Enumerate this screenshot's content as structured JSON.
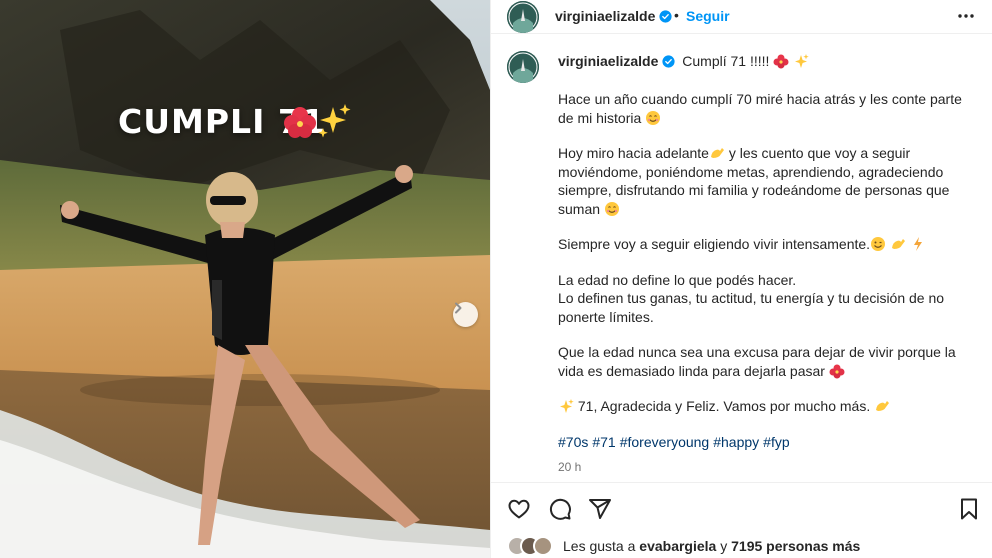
{
  "post": {
    "username": "virginiaelizalde",
    "follow_label": "Seguir",
    "separator": "•"
  },
  "media": {
    "overlay_text": "CUMPLI 71",
    "overlay_emoji": [
      "hibiscus-emoji",
      "sparkles-emoji"
    ],
    "next_icon": "chevron-right-icon"
  },
  "caption": {
    "headline": "Cumplí 71 !!!!!",
    "paragraphs": [
      [
        "Hace un año cuando cumplí 70 miré hacia atrás y les conte parte",
        "de mi historia"
      ],
      [
        "Hoy miro hacia adelante",
        "y les cuento que voy a seguir",
        "moviéndome, poniéndome metas, aprendiendo, agradeciendo",
        "siempre, disfrutando mi familia y rodeándome de personas que",
        "suman"
      ],
      [
        "Siempre voy a seguir eligiendo vivir intensamente."
      ],
      [
        "La edad no define lo que podés hacer.",
        "Lo definen tus ganas, tu actitud, tu energía y tu decisión de no",
        "ponerte límites."
      ],
      [
        "Que la edad nunca sea una excusa para dejar de vivir porque la",
        "vida es demasiado linda para dejarla pasar"
      ],
      [
        "71, Agradecida y Feliz. Vamos por mucho más."
      ]
    ],
    "hashtags": [
      "#70s",
      "#71",
      "#foreveryoung",
      "#happy",
      "#fyp"
    ],
    "time": "20 h"
  },
  "likes": {
    "prefix": "Les gusta a",
    "user": "evabargiela",
    "joiner": "y",
    "count_text": "7195 personas más"
  },
  "colors": {
    "accent": "#0095f6",
    "hashtag": "#00376b",
    "muted": "#737373",
    "verified": "#0095f6"
  }
}
